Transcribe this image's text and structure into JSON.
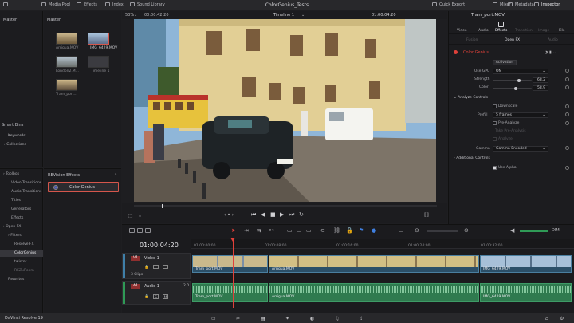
{
  "topbar": {
    "media_pool": "Media Pool",
    "effects": "Effects",
    "index": "Index",
    "sound_library": "Sound Library",
    "project_title": "ColorGenius_Tests",
    "quick_export": "Quick Export",
    "mixer": "Mixer",
    "metadata": "Metadata",
    "inspector": "Inspector"
  },
  "media": {
    "bin": "Master",
    "pool_header": "Master",
    "clips": [
      "Arrigua.MOV",
      "IMG_6429.MOV",
      "London2.M...",
      "Timeline 1",
      "Tram_port..."
    ],
    "smart_bins": "Smart Bins",
    "keywords": "Keywords",
    "collections": "Collections"
  },
  "viewer": {
    "zoom": "53%",
    "timecode_left": "00:00:42:20",
    "timeline_name": "Timeline 1",
    "timecode_right": "01:00:04:20"
  },
  "effects": {
    "tree": [
      "Toolbox",
      "Video Transitions",
      "Audio Transitions",
      "Titles",
      "Generators",
      "Effects",
      "Open FX",
      "Filters",
      "Resolve FX",
      "ColorGenius",
      "twistor",
      "REZuRoom",
      "Favorites"
    ],
    "group_title": "REVision Effects",
    "selected_effect": "Color Genius"
  },
  "inspector": {
    "clip_name": "Tram_port.MOV",
    "tabs": [
      "Video",
      "Audio",
      "Effects",
      "Transition",
      "Image",
      "File"
    ],
    "subtabs": [
      "Fusion",
      "Open FX",
      "Audio"
    ],
    "effect_name": "Color Genius",
    "activation": "Activation",
    "use_gpu_label": "Use GPU",
    "use_gpu_value": "ON",
    "strength_label": "Strength",
    "strength_value": "68.2",
    "strength_level": 0.68,
    "color_label": "Color",
    "color_value": "58.9",
    "color_level": 0.59,
    "analyze_controls": "Analyze Controls",
    "downscale": "Downscale",
    "prefill_label": "Prefill",
    "prefill_value": "5 frames",
    "pre_analyze": "Pre-Analyze",
    "take_pre_analysis": "Take Pre-Analysis",
    "analyze": "Analyze",
    "gamma_label": "Gamma",
    "gamma_value": "Gamma Encoded",
    "additional_controls": "Additional Controls",
    "use_alpha": "Use Alpha"
  },
  "timeline": {
    "timecode": "01:00:04:20",
    "ruler": [
      "01:00:00:00",
      "01:00:08:00",
      "01:00:16:00",
      "01:00:24:00",
      "01:00:32:00"
    ],
    "v1_tag": "V1",
    "video_track": "Video 1",
    "clips_count": "3 Clips",
    "a1_tag": "A1",
    "audio_track": "Audio 1",
    "audio_level": "2.0",
    "v_clips": [
      "Tram_port.MOV",
      "Arrigua.MOV",
      "IMG_6429.MOV"
    ],
    "a_clips": [
      "Tram_port.MOV",
      "Arrigua.MOV",
      "IMG_6429.MOV"
    ],
    "dim": "DIM"
  },
  "footer": {
    "app_name": "DaVinci Resolve 19"
  },
  "colors": {
    "accent_red": "#e0413a",
    "selected_clip_border": "#d5564c",
    "video_clip": "#3f6f8f",
    "audio_clip": "#2f7a4f"
  }
}
